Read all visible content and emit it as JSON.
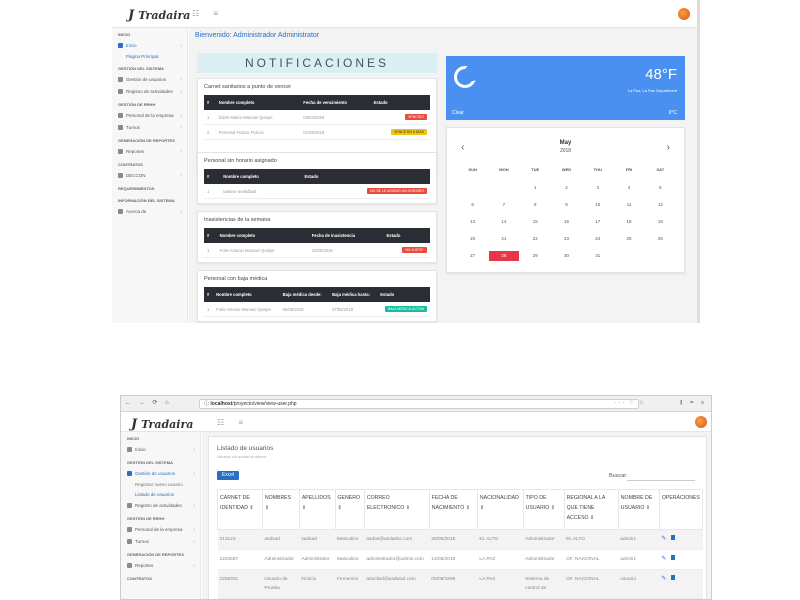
{
  "app": {
    "brand": "Tradaira",
    "brand_mark": "J"
  },
  "colors": {
    "primary": "#2a6fc4",
    "weather_bg": "#4a90f0",
    "table_head": "#2a2d33",
    "today": "#e8364b",
    "badge_red": "#e74c3c",
    "badge_yellow": "#f1c40f",
    "badge_teal": "#1abc9c"
  },
  "panel1": {
    "sidebar": {
      "sections": [
        {
          "head": "INICIO",
          "items": [
            {
              "label": "Inicio",
              "icon": "home-icon",
              "active": true
            },
            {
              "label": "Página Principal",
              "sub": true
            }
          ]
        },
        {
          "head": "GESTIÓN DEL SISTEMA",
          "items": [
            {
              "label": "Gestión de usuarios",
              "icon": "user-icon"
            },
            {
              "label": "Registro de actividades",
              "icon": "list-icon"
            }
          ]
        },
        {
          "head": "GESTIÓN DE RRHH",
          "items": [
            {
              "label": "Personal de la empresa",
              "icon": "people-icon"
            },
            {
              "label": "Turnos",
              "icon": "clock-icon"
            }
          ]
        },
        {
          "head": "GENERACIÓN DE REPORTES",
          "items": [
            {
              "label": "Reportes",
              "icon": "chart-icon"
            }
          ]
        },
        {
          "head": "CONTRATOS",
          "items": [
            {
              "label": "DECCON",
              "icon": "doc-icon"
            }
          ]
        },
        {
          "head": "REQUERIMIENTOS",
          "items": []
        },
        {
          "head": "INFORMACIÓN DEL SISTEMA",
          "items": [
            {
              "label": "Acerca de",
              "icon": "info-icon"
            }
          ]
        }
      ]
    },
    "welcome": "Bienvenido: Administrador Administrator",
    "notif_title": "NOTIFICACIONES",
    "cards": {
      "carnet": {
        "title": "Carnet sanitarios a punto de vencer",
        "headers": [
          "#",
          "Nombre completo",
          "Fecha de vencimiento",
          "Estado"
        ],
        "rows": [
          {
            "n": "1",
            "name": "Dúvis Mateo Mamani Quispe",
            "date": "04/04/2018",
            "status": "VENCIDO",
            "badge": "red"
          },
          {
            "n": "2",
            "name": "Personal Ficticio Ficticio",
            "date": "01/05/2018",
            "status": "VENCE EN 5 DÍAS",
            "badge": "yellow"
          }
        ]
      },
      "horario": {
        "title": "Personal sin horario asignado",
        "headers": [
          "#",
          "Nombre completo",
          "Estado"
        ],
        "rows": [
          {
            "n": "1",
            "name": "taeluse aedsdbad",
            "status": "NO SE LE ASIGNÓ UN HORARIO",
            "badge": "red"
          }
        ]
      },
      "inasistencias": {
        "title": "Inasistencias de la semana",
        "headers": [
          "#",
          "Nombre completo",
          "Fecha de inasistencia",
          "Estado"
        ],
        "rows": [
          {
            "n": "1",
            "name": "Fotis Antonio Mamani Quispe",
            "date": "23/05/2018",
            "status": "NO JUSTIF.",
            "badge": "red"
          }
        ]
      },
      "baja": {
        "title": "Personal con baja médica",
        "headers": [
          "#",
          "Nombre completo",
          "Baja médica desde:",
          "Baja médica hasta:",
          "Estado"
        ],
        "rows": [
          {
            "n": "1",
            "name": "Fotis Antonio Mamani Quispe",
            "from": "06/05/2018",
            "to": "07/05/2018",
            "status": "BAJA MÉDICA ACTIVA",
            "badge": "teal"
          }
        ]
      }
    },
    "weather": {
      "temp": "48°F",
      "location": "La Paz, La Paz Department",
      "condition": "Clear",
      "low": "9°C",
      "icon": "moon-icon"
    },
    "calendar": {
      "month": "May",
      "year": "2018",
      "days": [
        "SUN",
        "MON",
        "TUE",
        "WED",
        "THU",
        "FRI",
        "SAT"
      ],
      "weeks": [
        [
          "",
          "",
          "1",
          "2",
          "3",
          "4",
          "5"
        ],
        [
          "6",
          "7",
          "8",
          "9",
          "10",
          "11",
          "12"
        ],
        [
          "13",
          "14",
          "15",
          "16",
          "17",
          "18",
          "19"
        ],
        [
          "20",
          "21",
          "22",
          "23",
          "24",
          "25",
          "26"
        ],
        [
          "27",
          "28",
          "29",
          "30",
          "31",
          "",
          ""
        ]
      ],
      "today": "28"
    }
  },
  "panel2": {
    "browser": {
      "url": "localhost/proyecto/view/view-user.php",
      "url_host": "localhost"
    },
    "sidebar": {
      "sections": [
        {
          "head": "INICIO",
          "items": [
            {
              "label": "Inicio",
              "icon": "home-icon"
            }
          ]
        },
        {
          "head": "GESTIÓN DEL SISTEMA",
          "items": [
            {
              "label": "Gestión de usuarios",
              "icon": "user-icon",
              "active": true
            },
            {
              "label": "Registrar nuevo usuario",
              "sub": true,
              "plain": true
            },
            {
              "label": "Listado de usuarios",
              "sub": true
            },
            {
              "label": "Registro de actividades",
              "icon": "list-icon"
            }
          ]
        },
        {
          "head": "GESTIÓN DE RRHH",
          "items": [
            {
              "label": "Personal de la empresa",
              "icon": "people-icon"
            },
            {
              "label": "Turnos",
              "icon": "clock-icon"
            }
          ]
        },
        {
          "head": "GENERACIÓN DE REPORTES",
          "items": [
            {
              "label": "Reportes",
              "icon": "chart-icon"
            }
          ]
        },
        {
          "head": "CONTRATOS",
          "items": []
        }
      ]
    },
    "list": {
      "title": "Listado de usuarios",
      "subtitle": "Usuarios con acceso al sistema",
      "excel": "Excel",
      "search_label": "Buscar:",
      "headers": [
        "CARNET DE IDENTIDAD",
        "NOMBRES",
        "APELLIDOS",
        "GENERO",
        "CORREO ELECTRONICO",
        "FECHA DE NACIMIENTO",
        "NACIONALIDAD",
        "TIPO DE USUARIO",
        "REGIONAL A LA QUE TIENE ACCESO",
        "NOMBRE DE USUARIO",
        "OPERACIONES"
      ],
      "rows": [
        [
          "213123",
          "asdsad",
          "sadsad",
          "Masculino",
          "asdas@asdadsc.com",
          "25/05/2018",
          "EL ALTO",
          "Administrador",
          "EL ALTO",
          "admin1"
        ],
        [
          "1234567",
          "Administrador",
          "Administrator",
          "Masculino",
          "administrador@admin.com",
          "14/05/2018",
          "LA PAZ",
          "Administrador",
          "OF. NACIONAL",
          "admin1"
        ],
        [
          "2258331",
          "Usuario de Prueba",
          "Ficticio",
          "Femenino",
          "asacfwd@asdwad.com",
          "05/08/1996",
          "LA PAZ",
          "Sistema de control de",
          "OF. NACIONAL",
          "usuario"
        ]
      ]
    }
  }
}
